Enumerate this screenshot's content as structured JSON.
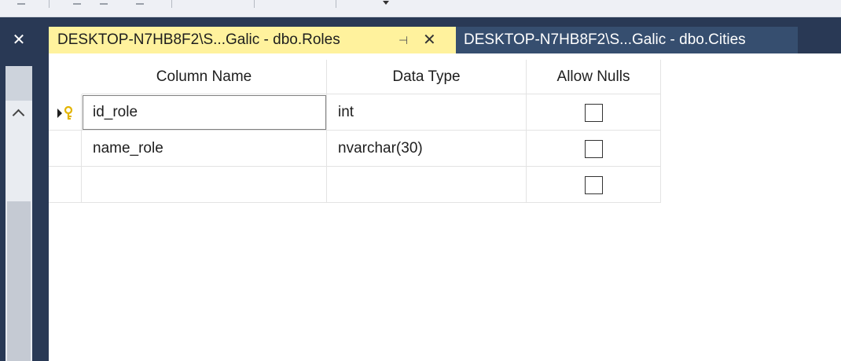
{
  "tabs": [
    {
      "label": "DESKTOP-N7HB8F2\\S...Galic - dbo.Roles",
      "active": true,
      "pinned_icon": "pin-icon",
      "close_icon": "close-icon"
    },
    {
      "label": "DESKTOP-N7HB8F2\\S...Galic - dbo.Cities",
      "active": false
    }
  ],
  "panel": {
    "close_glyph": "✕",
    "close_icon": "close-icon"
  },
  "tab_icons": {
    "pin": "⊣",
    "close": "✕"
  },
  "grid": {
    "headers": [
      "Column Name",
      "Data Type",
      "Allow Nulls"
    ],
    "rows": [
      {
        "column_name": "id_role",
        "data_type": "int",
        "allow_nulls": false,
        "primary_key": true
      },
      {
        "column_name": "name_role",
        "data_type": "nvarchar(30)",
        "allow_nulls": false,
        "primary_key": false
      },
      {
        "column_name": "",
        "data_type": "",
        "allow_nulls": false,
        "primary_key": false
      }
    ]
  },
  "colors": {
    "frame": "#293955",
    "active_tab": "#fff29d",
    "inactive_tab": "#364e6f",
    "key_icon": "#e3b400"
  }
}
